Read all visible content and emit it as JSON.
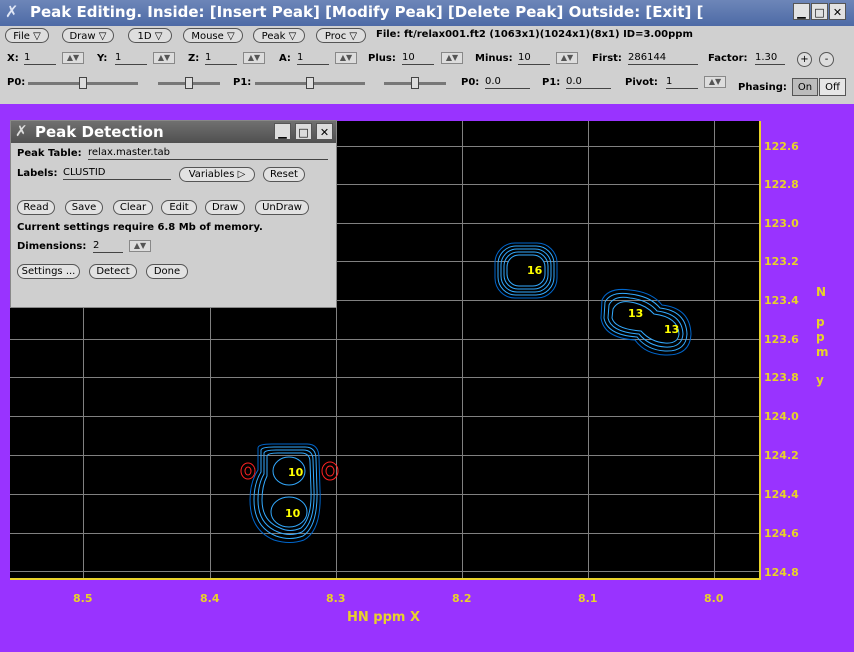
{
  "window": {
    "title": "Peak Editing.  Inside:  [Insert Peak] [Modify Peak] [Delete Peak]   Outside: [Exit] [",
    "minimize": "▁",
    "maximize": "□",
    "close": "✕"
  },
  "menus": [
    "File",
    "Draw",
    "1D",
    "Mouse",
    "Peak",
    "Proc"
  ],
  "file_info": "File: ft/relax001.ft2 (1063x1)(1024x1)(8x1) ID=3.00ppm",
  "row2": {
    "x_label": "X:",
    "x_value": "1",
    "y_label": "Y:",
    "y_value": "1",
    "z_label": "Z:",
    "z_value": "1",
    "a_label": "A:",
    "a_value": "1",
    "plus_label": "Plus:",
    "plus_value": "10",
    "minus_label": "Minus:",
    "minus_value": "10",
    "first_label": "First:",
    "first_value": "286144",
    "factor_label": "Factor:",
    "factor_value": "1.30",
    "plus_btn": "+",
    "minus_btn": "-"
  },
  "row3": {
    "p0_label": "P0:",
    "p1_label": "P1:",
    "p0_value_label": "P0:",
    "p0_value": "0.0",
    "p1_value_label": "P1:",
    "p1_value": "0.0",
    "pivot_label": "Pivot:",
    "pivot_value": "1",
    "phasing_label": "Phasing:",
    "on_label": "On",
    "off_label": "Off",
    "p0_slider_level": 0.5,
    "p1_slider_level": 0.5
  },
  "dialog": {
    "title": "Peak Detection",
    "peak_table_label": "Peak Table:",
    "peak_table_value": "relax.master.tab",
    "labels_label": "Labels:",
    "labels_value": "CLUSTID",
    "variables_button": "Variables ▷",
    "reset_button": "Reset",
    "read_button": "Read",
    "save_button": "Save",
    "clear_button": "Clear",
    "edit_button": "Edit",
    "draw_button": "Draw",
    "undraw_button": "UnDraw",
    "memory_text": "Current settings require 6.8 Mb of memory.",
    "dimensions_label": "Dimensions:",
    "dimensions_value": "2",
    "settings_button": "Settings ...",
    "detect_button": "Detect",
    "done_button": "Done"
  },
  "spectrum": {
    "x_axis_title": "HN ppm X",
    "y_axis_letters": [
      "N",
      "p",
      "p",
      "m",
      "y"
    ],
    "x_ticks": [
      "8.5",
      "8.4",
      "8.3",
      "8.2",
      "8.1",
      "8.0"
    ],
    "y_ticks": [
      "122.6",
      "122.8",
      "123.0",
      "123.2",
      "123.4",
      "123.6",
      "123.8",
      "124.0",
      "124.2",
      "124.4",
      "124.6",
      "124.8"
    ],
    "peak_labels": [
      "16",
      "13",
      "13",
      "10",
      "10"
    ],
    "colors": {
      "background": "#9933ff",
      "plot": "#000000",
      "axis_text": "#e8d22a",
      "contour_positive": "#33aaff",
      "contour_negative": "#ff2222",
      "peak_label": "#ffff00"
    }
  }
}
